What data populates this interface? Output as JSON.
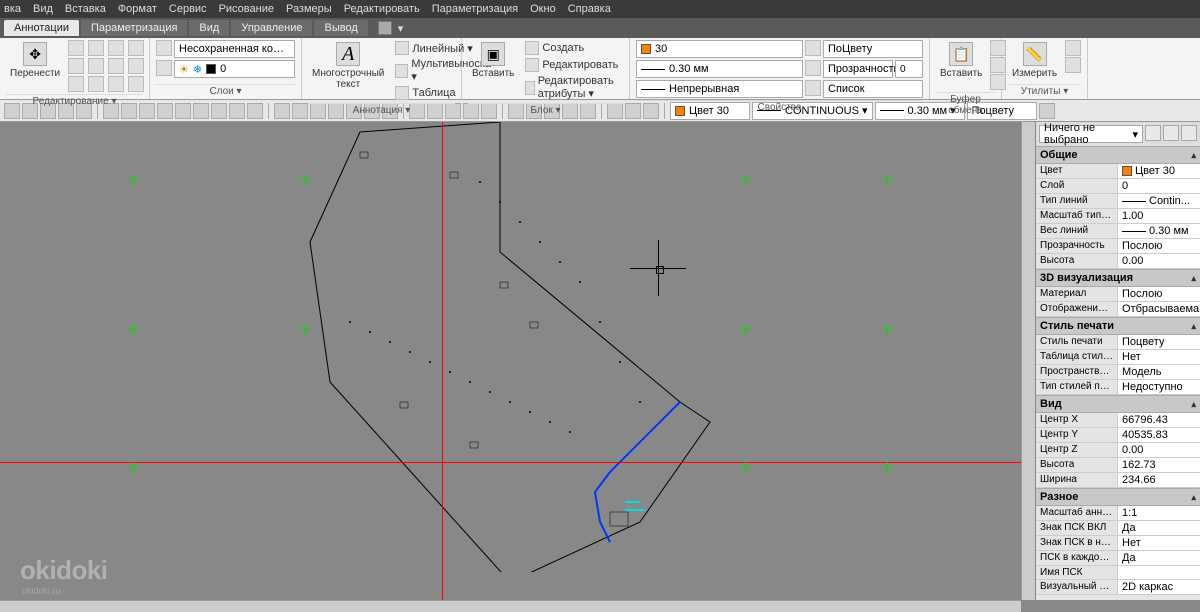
{
  "menu": {
    "items": [
      "вка",
      "Вид",
      "Вставка",
      "Формат",
      "Сервис",
      "Рисование",
      "Размеры",
      "Редактировать",
      "Параметризация",
      "Окно",
      "Справка"
    ]
  },
  "tabs": {
    "items": [
      "Аннотации",
      "Параметризация",
      "Вид",
      "Управление",
      "Вывод"
    ],
    "active": 0
  },
  "ribbon": {
    "edit": {
      "title": "Редактирование ▾",
      "move_label": "Перенести"
    },
    "layers": {
      "title": "Слои ▾",
      "config_label": "Несохраненная конфигурация сл",
      "layer_value": "0"
    },
    "annotation": {
      "title": "Аннотация ▾",
      "mtext": "Многострочный текст",
      "linear": "Линейный ▾",
      "multiLeader": "Мультивыноска ▾",
      "table": "Таблица"
    },
    "block": {
      "title": "Блок ▾",
      "insert": "Вставить",
      "create": "Создать",
      "edit": "Редактировать",
      "attr": "Редактировать атрибуты ▾"
    },
    "properties": {
      "title": "Свойства",
      "color_combo": "30",
      "bycolor": "ПоЦвету",
      "lineweight": "0.30 мм",
      "transparency_label": "Прозрачность",
      "transparency_value": "0",
      "linetype": "Непрерывная",
      "list": "Список"
    },
    "clipboard": {
      "title": "Буфер обмена",
      "paste": "Вставить"
    },
    "utils": {
      "title": "Утилиты ▾",
      "measure": "Измерить"
    }
  },
  "toolbar2": {
    "layer_color_combo": "Цвет 30",
    "linetype_combo": "CONTINUOUS ▾",
    "lineweight_combo": "0.30 мм ▾",
    "plot_combo": "Поцвету"
  },
  "properties_panel": {
    "selection": "Ничего не выбрано",
    "sections": {
      "general": {
        "title": "Общие",
        "rows": [
          {
            "k": "Цвет",
            "v": "Цвет 30",
            "sw": "#ff8000"
          },
          {
            "k": "Слой",
            "v": "0"
          },
          {
            "k": "Тип линий",
            "v": "Contin...",
            "line": true
          },
          {
            "k": "Масштаб типа л...",
            "v": "1.00"
          },
          {
            "k": "Вес линий",
            "v": "0.30 мм",
            "line": true
          },
          {
            "k": "Прозрачность",
            "v": "Послою"
          },
          {
            "k": "Высота",
            "v": "0.00"
          }
        ]
      },
      "viz3d": {
        "title": "3D визуализация",
        "rows": [
          {
            "k": "Материал",
            "v": "Послою"
          },
          {
            "k": "Отображение те...",
            "v": "Отбрасываема..."
          }
        ]
      },
      "plotstyle": {
        "title": "Стиль печати",
        "rows": [
          {
            "k": "Стиль печати",
            "v": "Поцвету"
          },
          {
            "k": "Таблица стилей ...",
            "v": "Нет"
          },
          {
            "k": "Пространство та...",
            "v": "Модель"
          },
          {
            "k": "Тип стилей печати",
            "v": "Недоступно"
          }
        ]
      },
      "view": {
        "title": "Вид",
        "rows": [
          {
            "k": "Центр X",
            "v": "66796.43"
          },
          {
            "k": "Центр Y",
            "v": "40535.83"
          },
          {
            "k": "Центр Z",
            "v": "0.00"
          },
          {
            "k": "Высота",
            "v": "162.73"
          },
          {
            "k": "Ширина",
            "v": "234.66"
          }
        ]
      },
      "misc": {
        "title": "Разное",
        "rows": [
          {
            "k": "Масштаб аннота...",
            "v": "1:1"
          },
          {
            "k": "Знак ПСК ВКЛ",
            "v": "Да"
          },
          {
            "k": "Знак ПСК в нач. ...",
            "v": "Нет"
          },
          {
            "k": "ПСК в каждом В...",
            "v": "Да"
          },
          {
            "k": "Имя ПСК",
            "v": ""
          },
          {
            "k": "Визуальный стиль",
            "v": "2D каркас"
          }
        ]
      }
    }
  },
  "watermark": {
    "main": "okidoki",
    "sub": "okidoki.ru"
  }
}
